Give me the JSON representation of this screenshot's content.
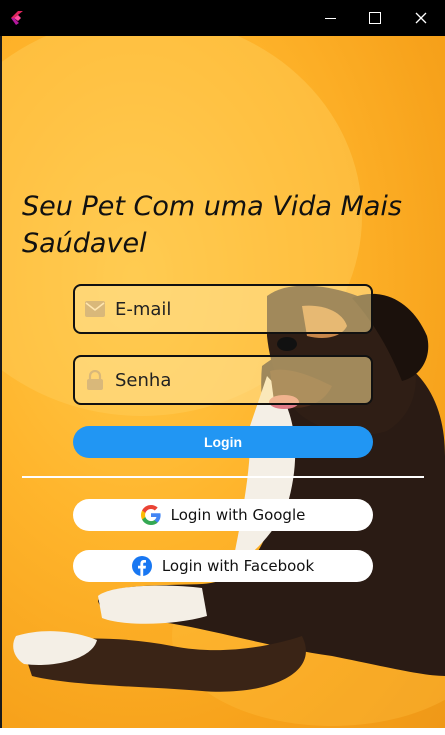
{
  "window": {
    "app_icon": "flutter-logo-icon",
    "controls": [
      "minimize-icon",
      "maximize-icon",
      "close-icon"
    ]
  },
  "headline": "Seu Pet Com uma Vida Mais Saúdavel",
  "email": {
    "placeholder": "E-mail",
    "value": "",
    "icon": "mail-icon"
  },
  "password": {
    "placeholder": "Senha",
    "value": "",
    "icon": "lock-icon"
  },
  "login_button": {
    "label": "Login",
    "color": "#2196f3"
  },
  "google_button": {
    "label": "Login with Google",
    "icon": "google-icon"
  },
  "facebook_button": {
    "label": "Login with Facebook",
    "icon": "facebook-icon",
    "color": "#1877f2"
  },
  "colors": {
    "background": "#ffb52c",
    "field_border": "#111111",
    "divider": "#ffffff"
  }
}
